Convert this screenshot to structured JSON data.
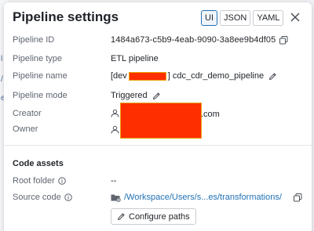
{
  "background": {
    "letters": [
      "l",
      "/",
      "e"
    ]
  },
  "modal": {
    "title": "Pipeline settings",
    "view_modes": [
      "UI",
      "JSON",
      "YAML"
    ],
    "active_view": "UI"
  },
  "fields": {
    "pipeline_id": {
      "label": "Pipeline ID",
      "value": "1484a673-c5b9-4eab-9090-3a8ee9b4df05"
    },
    "pipeline_type": {
      "label": "Pipeline type",
      "value": "ETL pipeline"
    },
    "pipeline_name": {
      "label": "Pipeline name",
      "prefix": "[dev",
      "suffix": "] cdc_cdr_demo_pipeline"
    },
    "pipeline_mode": {
      "label": "Pipeline mode",
      "value": "Triggered"
    },
    "creator": {
      "label": "Creator",
      "suffix": ".com"
    },
    "owner": {
      "label": "Owner"
    }
  },
  "code_assets": {
    "heading": "Code assets",
    "root_folder": {
      "label": "Root folder",
      "value": "--"
    },
    "source_code": {
      "label": "Source code",
      "value": "/Workspace/Users/s...es/transformations/"
    },
    "configure_button": "Configure paths"
  },
  "colors": {
    "redaction": "#ff2e00",
    "link": "#2272b4"
  }
}
